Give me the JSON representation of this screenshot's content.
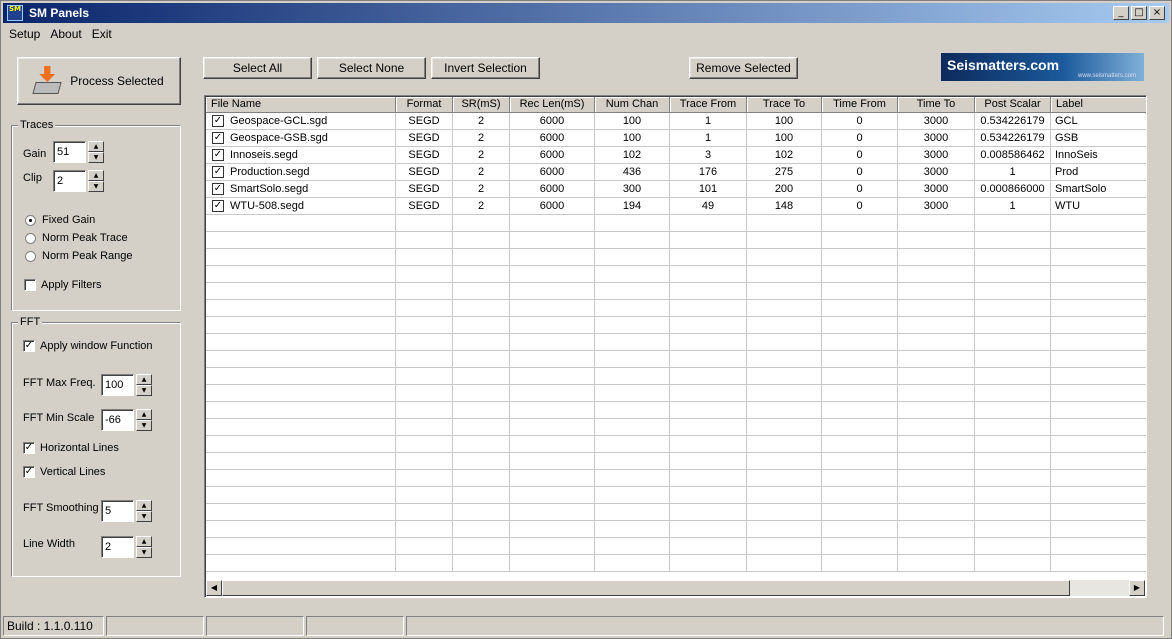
{
  "window": {
    "title": "SM Panels",
    "icon_text": "SM",
    "buttons": {
      "minimize": "_",
      "maximize": "□",
      "close": "×"
    }
  },
  "menu": [
    "Setup",
    "About",
    "Exit"
  ],
  "process_button": {
    "label": "Process Selected"
  },
  "toolbar": {
    "select_all": "Select All",
    "select_none": "Select None",
    "invert_selection": "Invert Selection",
    "remove_selected": "Remove Selected"
  },
  "logo": {
    "text": "Seismatters.com",
    "sub": "www.seismatters.com"
  },
  "traces": {
    "label": "Traces",
    "gain_label": "Gain",
    "gain_value": "51",
    "clip_label": "Clip",
    "clip_value": "2",
    "radios": [
      {
        "label": "Fixed Gain",
        "selected": true
      },
      {
        "label": "Norm Peak Trace",
        "selected": false
      },
      {
        "label": "Norm Peak Range",
        "selected": false
      }
    ],
    "apply_filters": {
      "label": "Apply Filters",
      "checked": false
    }
  },
  "fft": {
    "label": "FFT",
    "apply_window": {
      "label": "Apply window Function",
      "checked": true
    },
    "max_freq_label": "FFT Max Freq.",
    "max_freq_value": "100",
    "min_scale_label": "FFT Min Scale",
    "min_scale_value": "-66",
    "horizontal_lines": {
      "label": "Horizontal Lines",
      "checked": true
    },
    "vertical_lines": {
      "label": "Vertical Lines",
      "checked": true
    },
    "smoothing_label": "FFT Smoothing",
    "smoothing_value": "5",
    "line_width_label": "Line Width",
    "line_width_value": "2"
  },
  "table": {
    "columns": [
      "File Name",
      "Format",
      "SR(mS)",
      "Rec Len(mS)",
      "Num Chan",
      "Trace From",
      "Trace To",
      "Time From",
      "Time To",
      "Post Scalar",
      "Label"
    ],
    "rows": [
      {
        "checked": true,
        "cells": [
          "Geospace-GCL.sgd",
          "SEGD",
          "2",
          "6000",
          "100",
          "1",
          "100",
          "0",
          "3000",
          "0.534226179",
          "GCL"
        ]
      },
      {
        "checked": true,
        "cells": [
          "Geospace-GSB.sgd",
          "SEGD",
          "2",
          "6000",
          "100",
          "1",
          "100",
          "0",
          "3000",
          "0.534226179",
          "GSB"
        ]
      },
      {
        "checked": true,
        "cells": [
          "Innoseis.segd",
          "SEGD",
          "2",
          "6000",
          "102",
          "3",
          "102",
          "0",
          "3000",
          "0.008586462",
          "InnoSeis"
        ]
      },
      {
        "checked": true,
        "cells": [
          "Production.segd",
          "SEGD",
          "2",
          "6000",
          "436",
          "176",
          "275",
          "0",
          "3000",
          "1",
          "Prod"
        ]
      },
      {
        "checked": true,
        "cells": [
          "SmartSolo.segd",
          "SEGD",
          "2",
          "6000",
          "300",
          "101",
          "200",
          "0",
          "3000",
          "0.000866000",
          "SmartSolo"
        ]
      },
      {
        "checked": true,
        "cells": [
          "WTU-508.segd",
          "SEGD",
          "2",
          "6000",
          "194",
          "49",
          "148",
          "0",
          "3000",
          "1",
          "WTU"
        ]
      }
    ]
  },
  "status": {
    "build": "Build : 1.1.0.110"
  }
}
